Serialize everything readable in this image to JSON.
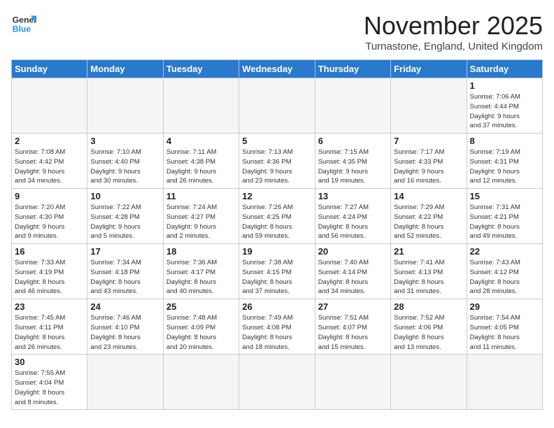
{
  "logo": {
    "line1": "General",
    "line2": "Blue"
  },
  "title": "November 2025",
  "subtitle": "Turnastone, England, United Kingdom",
  "days_header": [
    "Sunday",
    "Monday",
    "Tuesday",
    "Wednesday",
    "Thursday",
    "Friday",
    "Saturday"
  ],
  "weeks": [
    [
      {
        "day": "",
        "info": ""
      },
      {
        "day": "",
        "info": ""
      },
      {
        "day": "",
        "info": ""
      },
      {
        "day": "",
        "info": ""
      },
      {
        "day": "",
        "info": ""
      },
      {
        "day": "",
        "info": ""
      },
      {
        "day": "1",
        "info": "Sunrise: 7:06 AM\nSunset: 4:44 PM\nDaylight: 9 hours\nand 37 minutes."
      }
    ],
    [
      {
        "day": "2",
        "info": "Sunrise: 7:08 AM\nSunset: 4:42 PM\nDaylight: 9 hours\nand 34 minutes."
      },
      {
        "day": "3",
        "info": "Sunrise: 7:10 AM\nSunset: 4:40 PM\nDaylight: 9 hours\nand 30 minutes."
      },
      {
        "day": "4",
        "info": "Sunrise: 7:11 AM\nSunset: 4:38 PM\nDaylight: 9 hours\nand 26 minutes."
      },
      {
        "day": "5",
        "info": "Sunrise: 7:13 AM\nSunset: 4:36 PM\nDaylight: 9 hours\nand 23 minutes."
      },
      {
        "day": "6",
        "info": "Sunrise: 7:15 AM\nSunset: 4:35 PM\nDaylight: 9 hours\nand 19 minutes."
      },
      {
        "day": "7",
        "info": "Sunrise: 7:17 AM\nSunset: 4:33 PM\nDaylight: 9 hours\nand 16 minutes."
      },
      {
        "day": "8",
        "info": "Sunrise: 7:19 AM\nSunset: 4:31 PM\nDaylight: 9 hours\nand 12 minutes."
      }
    ],
    [
      {
        "day": "9",
        "info": "Sunrise: 7:20 AM\nSunset: 4:30 PM\nDaylight: 9 hours\nand 9 minutes."
      },
      {
        "day": "10",
        "info": "Sunrise: 7:22 AM\nSunset: 4:28 PM\nDaylight: 9 hours\nand 5 minutes."
      },
      {
        "day": "11",
        "info": "Sunrise: 7:24 AM\nSunset: 4:27 PM\nDaylight: 9 hours\nand 2 minutes."
      },
      {
        "day": "12",
        "info": "Sunrise: 7:26 AM\nSunset: 4:25 PM\nDaylight: 8 hours\nand 59 minutes."
      },
      {
        "day": "13",
        "info": "Sunrise: 7:27 AM\nSunset: 4:24 PM\nDaylight: 8 hours\nand 56 minutes."
      },
      {
        "day": "14",
        "info": "Sunrise: 7:29 AM\nSunset: 4:22 PM\nDaylight: 8 hours\nand 52 minutes."
      },
      {
        "day": "15",
        "info": "Sunrise: 7:31 AM\nSunset: 4:21 PM\nDaylight: 8 hours\nand 49 minutes."
      }
    ],
    [
      {
        "day": "16",
        "info": "Sunrise: 7:33 AM\nSunset: 4:19 PM\nDaylight: 8 hours\nand 46 minutes."
      },
      {
        "day": "17",
        "info": "Sunrise: 7:34 AM\nSunset: 4:18 PM\nDaylight: 8 hours\nand 43 minutes."
      },
      {
        "day": "18",
        "info": "Sunrise: 7:36 AM\nSunset: 4:17 PM\nDaylight: 8 hours\nand 40 minutes."
      },
      {
        "day": "19",
        "info": "Sunrise: 7:38 AM\nSunset: 4:15 PM\nDaylight: 8 hours\nand 37 minutes."
      },
      {
        "day": "20",
        "info": "Sunrise: 7:40 AM\nSunset: 4:14 PM\nDaylight: 8 hours\nand 34 minutes."
      },
      {
        "day": "21",
        "info": "Sunrise: 7:41 AM\nSunset: 4:13 PM\nDaylight: 8 hours\nand 31 minutes."
      },
      {
        "day": "22",
        "info": "Sunrise: 7:43 AM\nSunset: 4:12 PM\nDaylight: 8 hours\nand 28 minutes."
      }
    ],
    [
      {
        "day": "23",
        "info": "Sunrise: 7:45 AM\nSunset: 4:11 PM\nDaylight: 8 hours\nand 26 minutes."
      },
      {
        "day": "24",
        "info": "Sunrise: 7:46 AM\nSunset: 4:10 PM\nDaylight: 8 hours\nand 23 minutes."
      },
      {
        "day": "25",
        "info": "Sunrise: 7:48 AM\nSunset: 4:09 PM\nDaylight: 8 hours\nand 20 minutes."
      },
      {
        "day": "26",
        "info": "Sunrise: 7:49 AM\nSunset: 4:08 PM\nDaylight: 8 hours\nand 18 minutes."
      },
      {
        "day": "27",
        "info": "Sunrise: 7:51 AM\nSunset: 4:07 PM\nDaylight: 8 hours\nand 15 minutes."
      },
      {
        "day": "28",
        "info": "Sunrise: 7:52 AM\nSunset: 4:06 PM\nDaylight: 8 hours\nand 13 minutes."
      },
      {
        "day": "29",
        "info": "Sunrise: 7:54 AM\nSunset: 4:05 PM\nDaylight: 8 hours\nand 11 minutes."
      }
    ],
    [
      {
        "day": "30",
        "info": "Sunrise: 7:55 AM\nSunset: 4:04 PM\nDaylight: 8 hours\nand 8 minutes."
      },
      {
        "day": "",
        "info": ""
      },
      {
        "day": "",
        "info": ""
      },
      {
        "day": "",
        "info": ""
      },
      {
        "day": "",
        "info": ""
      },
      {
        "day": "",
        "info": ""
      },
      {
        "day": "",
        "info": ""
      }
    ]
  ]
}
